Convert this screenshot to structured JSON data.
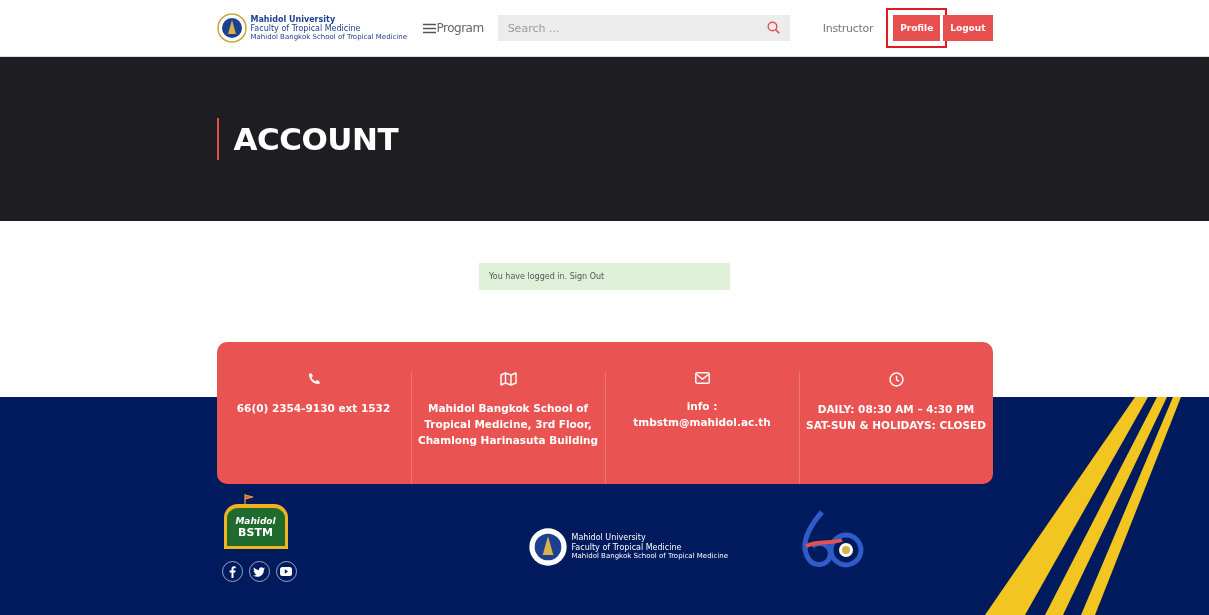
{
  "header": {
    "logo": {
      "line_1": "Mahidol University",
      "line_2": "Faculty of Tropical Medicine",
      "line_3": "Mahidol Bangkok School of Tropical Medicine"
    },
    "menu_label": "Program",
    "search": {
      "placeholder": "Search ..."
    },
    "nav": [
      {
        "label": "Instructor",
        "kind": "link",
        "highlighted": false
      },
      {
        "label": "Profile",
        "kind": "button",
        "highlighted": true
      },
      {
        "label": "Logout",
        "kind": "button",
        "highlighted": false
      }
    ]
  },
  "hero": {
    "title": "ACCOUNT"
  },
  "message": {
    "text": "You have logged in. Sign Out"
  },
  "contact": [
    {
      "kind": "phone",
      "lines": [
        "66(0) 2354-9130 ext 1532"
      ]
    },
    {
      "kind": "map",
      "lines": [
        "Mahidol Bangkok School of",
        "Tropical Medicine, 3rd Floor,",
        "Chamlong Harinasuta Building"
      ]
    },
    {
      "kind": "mail",
      "lines": [
        "info :",
        "tmbstm@mahidol.ac.th"
      ]
    },
    {
      "kind": "clock",
      "lines": [
        "DAILY: 08:30 AM – 4:30 PM",
        "SAT-SUN & HOLIDAYS: CLOSED"
      ]
    }
  ],
  "footer": {
    "bstm_logo": {
      "line_1": "Mahidol",
      "line_2": "BSTM"
    },
    "social": [
      {
        "kind": "facebook"
      },
      {
        "kind": "twitter"
      },
      {
        "kind": "youtube"
      }
    ],
    "center_logo": {
      "line_1": "Mahidol University",
      "line_2": "Faculty of Tropical Medicine",
      "line_3": "Mahidol Bangkok School of Tropical Medicine"
    }
  }
}
